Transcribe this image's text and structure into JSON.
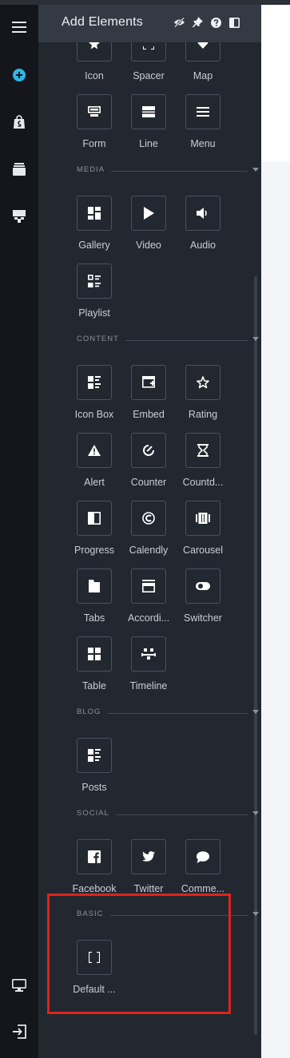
{
  "panel": {
    "title": "Add Elements"
  },
  "header_icons": [
    "eye-off-icon",
    "pin-icon",
    "help-icon",
    "sidebar-layout-icon"
  ],
  "rail_icons": [
    "menu-icon",
    "add-elements-icon",
    "shopify-icon",
    "layers-icon",
    "layout-icon",
    "desktop-icon",
    "exit-icon"
  ],
  "sections": {
    "media": "MEDIA",
    "content": "CONTENT",
    "blog": "BLOG",
    "social": "SOCIAL",
    "basic": "BASIC"
  },
  "items": {
    "icon": "Icon",
    "spacer": "Spacer",
    "map": "Map",
    "form": "Form",
    "line": "Line",
    "menu": "Menu",
    "gallery": "Gallery",
    "video": "Video",
    "audio": "Audio",
    "playlist": "Playlist",
    "iconbox": "Icon Box",
    "embed": "Embed",
    "rating": "Rating",
    "alert": "Alert",
    "counter": "Counter",
    "countdown": "Countd...",
    "progress": "Progress",
    "calendly": "Calendly",
    "carousel": "Carousel",
    "tabs": "Tabs",
    "accordion": "Accordi...",
    "switcher": "Switcher",
    "table": "Table",
    "timeline": "Timeline",
    "posts": "Posts",
    "facebook": "Facebook",
    "twitter": "Twitter",
    "comments": "Comme...",
    "default": "Default ..."
  },
  "colors": {
    "rail_bg": "#14161b",
    "panel_bg": "#232830",
    "accent": "#2eb7e4",
    "highlight": "#e0231a"
  }
}
